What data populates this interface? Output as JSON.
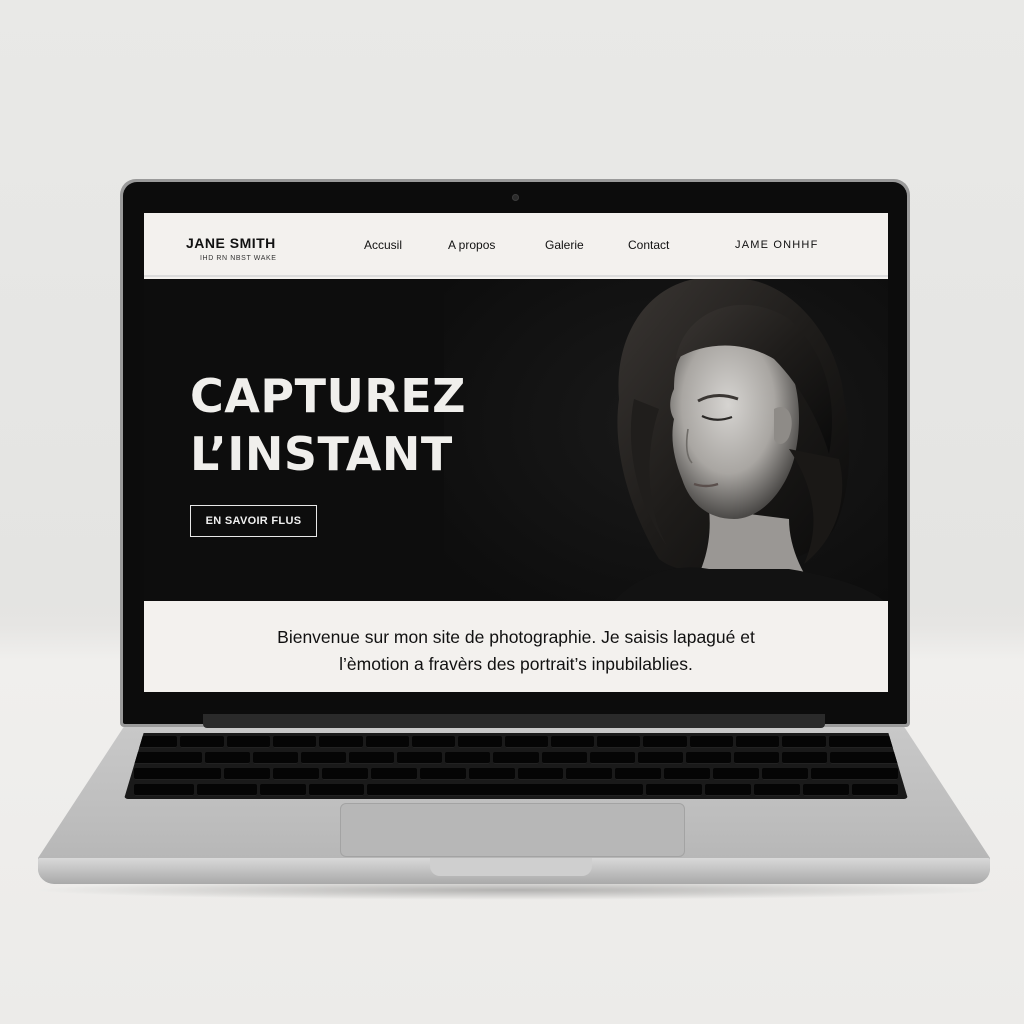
{
  "site": {
    "brand_name": "JANE SMITH",
    "brand_tagline": "IHD RN NBST WAKE",
    "nav": [
      {
        "label": "Accusil"
      },
      {
        "label": "A propos"
      },
      {
        "label": "Galerie"
      },
      {
        "label": "Contact"
      }
    ],
    "nav_right": "JAME ONHHF",
    "hero": {
      "title_line1": "CAPTUREZ",
      "title_line2": "L’INSTANT",
      "cta_label": "EN SAVOIR FLUS"
    },
    "intro": {
      "line1": "Bienvenue sur mon site de photographie.  Je saisis lapagué et",
      "line2": "l’èmotion a fravèrs des portrait’s inpubilablies."
    }
  },
  "colors": {
    "hero_background": "#0d0d0d",
    "page_background": "#f3f1ee",
    "text": "#111111"
  },
  "icons": [
    "webcam-icon"
  ]
}
